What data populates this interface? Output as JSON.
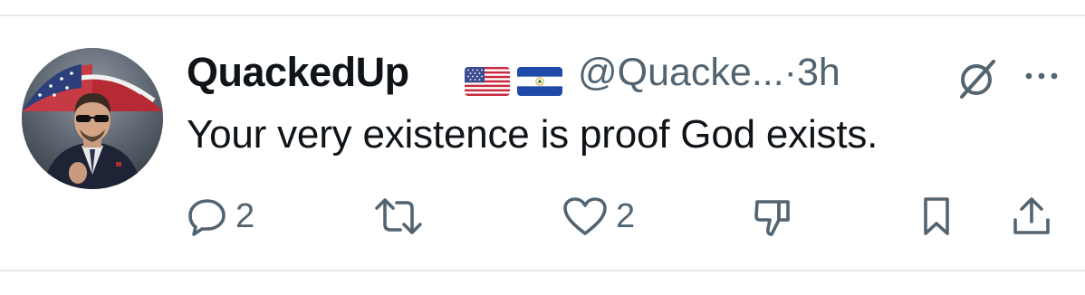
{
  "tweet": {
    "display_name": "QuackedUp",
    "flags": [
      "us-flag",
      "el-salvador-flag"
    ],
    "handle_time": "@Quacke...·3h",
    "text": "Your very existence is proof God exists.",
    "icons": {
      "grok": "grok-slash-icon",
      "more": "more-dots-icon"
    },
    "actions": {
      "reply": {
        "icon": "reply-icon",
        "count": "2"
      },
      "retweet": {
        "icon": "retweet-icon",
        "count": ""
      },
      "like": {
        "icon": "heart-icon",
        "count": "2"
      },
      "dislike": {
        "icon": "thumbs-down-icon",
        "count": ""
      },
      "bookmark": {
        "icon": "bookmark-icon",
        "count": ""
      },
      "share": {
        "icon": "share-icon",
        "count": ""
      }
    }
  },
  "colors": {
    "text_primary": "#0f1419",
    "text_secondary": "#536471",
    "divider": "#e7e9ea"
  }
}
